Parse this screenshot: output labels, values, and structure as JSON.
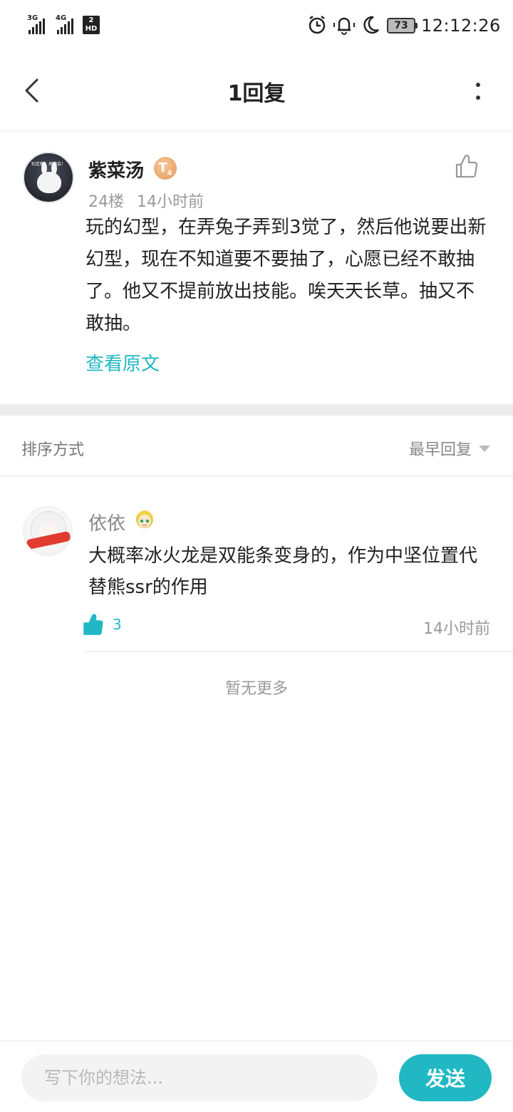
{
  "status_bar": {
    "network_1": "3G",
    "network_2": "4G",
    "sim_badge_top": "2",
    "sim_badge_bottom": "HD",
    "battery": "73",
    "time": "12:12:26"
  },
  "header": {
    "title": "1回复"
  },
  "main_post": {
    "author": "紫菜汤",
    "level_badge": "T",
    "level_sub": "4",
    "floor": "24楼",
    "time": "14小时前",
    "content": "玩的幻型，在弄兔子弄到3觉了，然后他说要出新幻型，现在不知道要不要抽了，心愿已经不敢抽了。他又不提前放出技能。唉天天长草。抽又不敢抽。",
    "view_original": "查看原文",
    "avatar_caption": "别走嘛！再聊会！"
  },
  "sort": {
    "label": "排序方式",
    "current": "最早回复"
  },
  "replies": [
    {
      "author": "依依",
      "content": "大概率冰火龙是双能条变身的，作为中坚位置代替熊ssr的作用",
      "likes": "3",
      "time": "14小时前"
    }
  ],
  "footer_note": "暂无更多",
  "composer": {
    "placeholder": "写下你的想法...",
    "send_label": "发送"
  },
  "colors": {
    "accent": "#21b8c4",
    "muted": "#999999",
    "divider": "#ececec"
  }
}
